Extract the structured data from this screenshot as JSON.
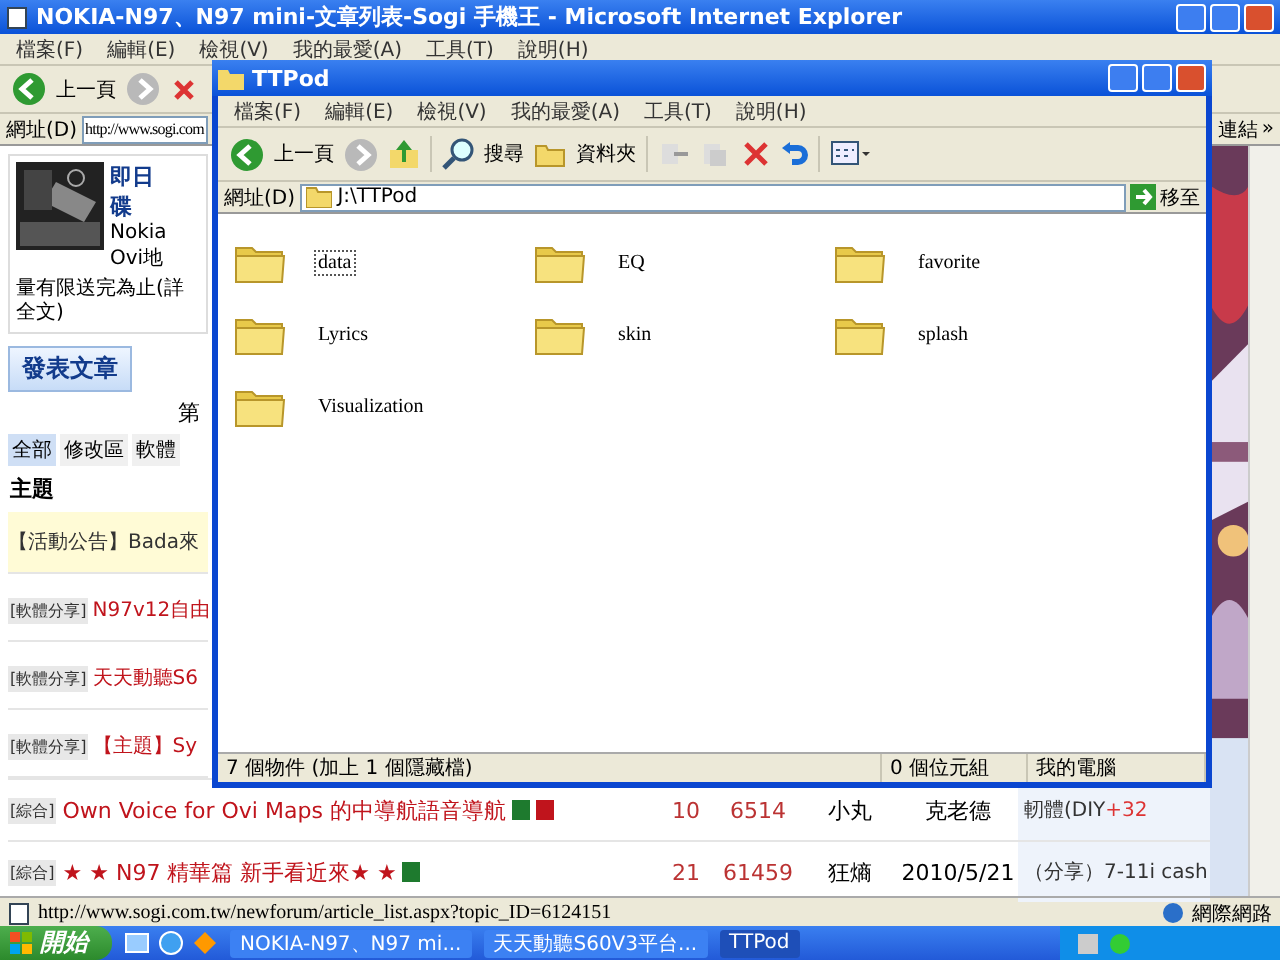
{
  "ie": {
    "title": "NOKIA-N97、N97 mini-文章列表-Sogi 手機王 - Microsoft Internet Explorer",
    "menu": [
      "檔案(F)",
      "編輯(E)",
      "檢視(V)",
      "我的最愛(A)",
      "工具(T)",
      "說明(H)"
    ],
    "back": "上一頁",
    "address_label": "網址(D)",
    "address": "http://www.sogi.com",
    "links": "連結",
    "more": "»",
    "page": {
      "headline": [
        "即日",
        "碟"
      ],
      "snippet": [
        "Nokia",
        "Ovi地"
      ],
      "note": "量有限送完為止(詳全文)",
      "post_button": "發表文章",
      "page_label": "第",
      "tabs": [
        {
          "label": "全部",
          "selected": true
        },
        {
          "label": "修改區",
          "selected": false
        },
        {
          "label": "軟體",
          "selected": false
        }
      ],
      "column_header": "主題",
      "topics": [
        {
          "kind": "notice",
          "title": "【活動公告】Bada來"
        },
        {
          "kind": "topic",
          "tag": "[軟體分享]",
          "title": "N97v12自由"
        },
        {
          "kind": "topic",
          "tag": "[軟體分享]",
          "title": "天天動聽S6"
        },
        {
          "kind": "topic",
          "tag": "[軟體分享]",
          "title": "【主題】Sy"
        }
      ],
      "rows": [
        {
          "tag": "[綜合]",
          "title": "Own Voice for Ovi Maps 的中導航語音導航",
          "badges": [
            {
              "color": "#1e7a2e"
            },
            {
              "color": "#c0141c"
            }
          ],
          "replies": "10",
          "views": "6514",
          "author": "小丸",
          "date": "克老德",
          "side": [
            "軔體(DIY",
            "+32"
          ]
        },
        {
          "tag": "[綜合]",
          "title": "★ ★ N97 精華篇 新手看近來★ ★",
          "badges": [
            {
              "color": "#1e7a2e"
            }
          ],
          "replies": "21",
          "views": "61459",
          "author": "狂熵",
          "date": "2010/5/21",
          "side": [
            "（分享）7-11i cash"
          ]
        }
      ]
    },
    "status_url": "http://www.sogi.com.tw/newforum/article_list.aspx?topic_ID=6124151",
    "zone": "網際網路"
  },
  "explorer": {
    "title": "TTPod",
    "menu": [
      "檔案(F)",
      "編輯(E)",
      "檢視(V)",
      "我的最愛(A)",
      "工具(T)",
      "說明(H)"
    ],
    "back": "上一頁",
    "search": "搜尋",
    "folders": "資料夾",
    "address_label": "網址(D)",
    "address": "J:\\TTPod",
    "go": "移至",
    "items": [
      {
        "name": "data",
        "selected": true
      },
      {
        "name": "EQ",
        "selected": false
      },
      {
        "name": "favorite",
        "selected": false
      },
      {
        "name": "Lyrics",
        "selected": false
      },
      {
        "name": "skin",
        "selected": false
      },
      {
        "name": "splash",
        "selected": false
      },
      {
        "name": "Visualization",
        "selected": false
      }
    ],
    "status": [
      "7 個物件 (加上 1 個隱藏檔)",
      "0 個位元組",
      "我的電腦"
    ]
  },
  "taskbar": {
    "start": "開始",
    "tasks": [
      {
        "label": "NOKIA-N97、N97 mi...",
        "selected": false
      },
      {
        "label": "天天動聽S60V3平台...",
        "selected": false
      },
      {
        "label": "TTPod",
        "selected": true
      }
    ]
  }
}
